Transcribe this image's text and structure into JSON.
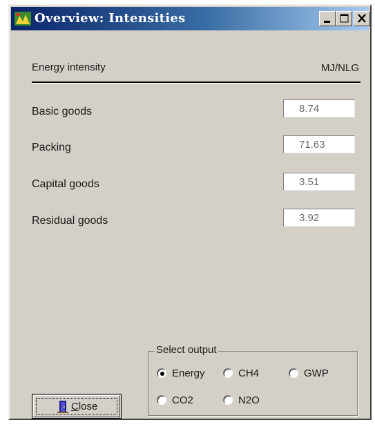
{
  "window": {
    "title": "Overview: Intensities",
    "controls": {
      "minimize": "minimize",
      "maximize": "maximize",
      "close": "close"
    }
  },
  "header": {
    "label": "Energy intensity",
    "unit": "MJ/NLG"
  },
  "rows": [
    {
      "label": "Basic goods",
      "value": "8.74"
    },
    {
      "label": "Packing",
      "value": "71.63"
    },
    {
      "label": "Capital goods",
      "value": "3.51"
    },
    {
      "label": "Residual goods",
      "value": "3.92"
    }
  ],
  "select_output": {
    "title": "Select output",
    "selected": "Energy",
    "options": [
      "Energy",
      "CH4",
      "GWP",
      "CO2",
      "N2O"
    ]
  },
  "close_button": {
    "label_first": "C",
    "label_rest": "lose"
  },
  "icons": {
    "app": "app-icon",
    "close_button": "door-icon"
  },
  "colors": {
    "titlebar_start": "#0a246a",
    "titlebar_end": "#a6caf0",
    "face": "#d4d0c8"
  }
}
